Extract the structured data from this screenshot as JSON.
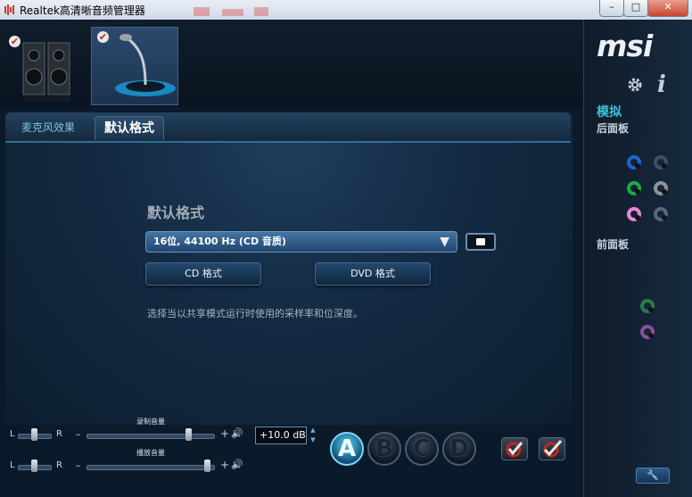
{
  "window": {
    "title": "Realtek高清晰音频管理器",
    "min_label": "–",
    "max_label": "□",
    "close_label": "✕"
  },
  "brand": {
    "logo": "msi"
  },
  "side": {
    "analog_label": "模拟",
    "rear_panel_label": "后面板",
    "front_panel_label": "前面板",
    "settings_icon": "gear-icon",
    "info_icon": "i",
    "wrench_label": "🔧"
  },
  "jacks": {
    "rear": [
      {
        "color": "#1e66c8",
        "active": true
      },
      {
        "color": "#3e5367",
        "active": false
      },
      {
        "color": "#1fa84a",
        "active": true
      },
      {
        "color": "#8b949c",
        "active": false
      },
      {
        "color": "#e58ad0",
        "active": true
      },
      {
        "color": "#58687a",
        "active": false
      }
    ],
    "front": [
      {
        "color": "#2a7d49"
      },
      {
        "color": "#8a4f9e"
      }
    ]
  },
  "tabs": [
    {
      "label": "麦克风效果",
      "active": false
    },
    {
      "label": "默认格式",
      "active": true
    }
  ],
  "format": {
    "title": "默认格式",
    "selected": "16位, 44100 Hz (CD 音质)",
    "arrow": "▼",
    "cd_button": "CD 格式",
    "dvd_button": "DVD 格式",
    "description": "选择当以共享模式运行时使用的采样率和位深度。"
  },
  "volume": {
    "record_label": "录制音量",
    "playback_label": "播放音量",
    "left": "L",
    "right": "R",
    "minus": "–",
    "plus": "+",
    "speaker": "🔊",
    "db_value": "+10.0 dB",
    "spin_up": "▲",
    "spin_down": "▼",
    "record_level": 0.82,
    "playback_level": 0.98
  },
  "letter_buttons": [
    {
      "label": "A",
      "active": true
    },
    {
      "label": "B",
      "active": false
    },
    {
      "label": "C",
      "active": false
    },
    {
      "label": "D",
      "active": false
    }
  ],
  "check_glyph": "✔"
}
